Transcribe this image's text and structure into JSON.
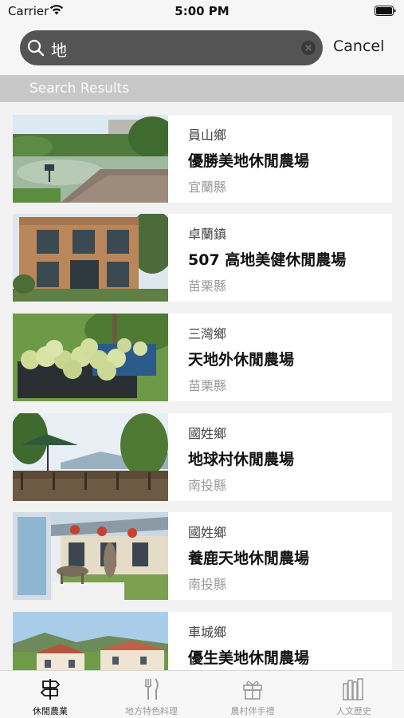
{
  "status_bar": {
    "carrier": "Carrier",
    "time": "5:00 PM"
  },
  "search": {
    "query": "地",
    "cancel_label": "Cancel"
  },
  "section": {
    "title": "Search Results"
  },
  "results": [
    {
      "township": "員山鄉",
      "name": "優勝美地休閒農場",
      "county": "宜蘭縣",
      "image": "pond-deck-photo"
    },
    {
      "township": "卓蘭鎮",
      "name": "507 高地美健休閒農場",
      "county": "苗栗縣",
      "image": "building-photo"
    },
    {
      "township": "三灣鄉",
      "name": "天地外休閒農場",
      "county": "苗栗縣",
      "image": "pomelo-crate-photo"
    },
    {
      "township": "國姓鄉",
      "name": "地球村休閒農場",
      "county": "南投縣",
      "image": "terrace-umbrella-photo"
    },
    {
      "township": "國姓鄉",
      "name": "養鹿天地休閒農場",
      "county": "南投縣",
      "image": "deer-statue-photo"
    },
    {
      "township": "車城鄉",
      "name": "優生美地休閒農場",
      "county": "",
      "image": "resort-photo"
    }
  ],
  "tabs": [
    {
      "label": "休閒農業",
      "icon": "signpost-icon",
      "active": true
    },
    {
      "label": "地方特色料理",
      "icon": "fork-knife-icon",
      "active": false
    },
    {
      "label": "農村伴手禮",
      "icon": "gift-icon",
      "active": false
    },
    {
      "label": "人文歷史",
      "icon": "books-icon",
      "active": false
    }
  ]
}
